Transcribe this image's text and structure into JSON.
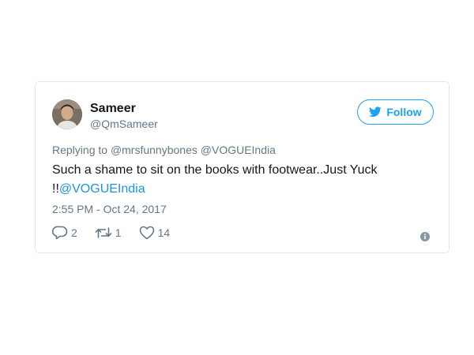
{
  "tweet": {
    "display_name": "Sameer",
    "handle": "@QmSameer",
    "follow_label": "Follow",
    "reply_prefix": "Replying to",
    "reply_to_1": "@mrsfunnybones",
    "reply_to_2": "@VOGUEIndia",
    "text_line_1": "Such a shame to sit on the books with footwear..Just Yuck",
    "text_prefix_2": "!!",
    "text_mention": "@VOGUEIndia",
    "timestamp": "2:55 PM - Oct 24, 2017",
    "replies": "2",
    "retweets": "1",
    "likes": "14"
  },
  "colors": {
    "accent": "#1da1f2",
    "mention": "#1b95e0",
    "muted": "#657786",
    "border": "#e1e8ed"
  },
  "icons": {
    "reply": "reply-icon",
    "retweet": "retweet-icon",
    "like": "heart-icon",
    "info": "info-icon",
    "bird": "twitter-bird-icon"
  }
}
